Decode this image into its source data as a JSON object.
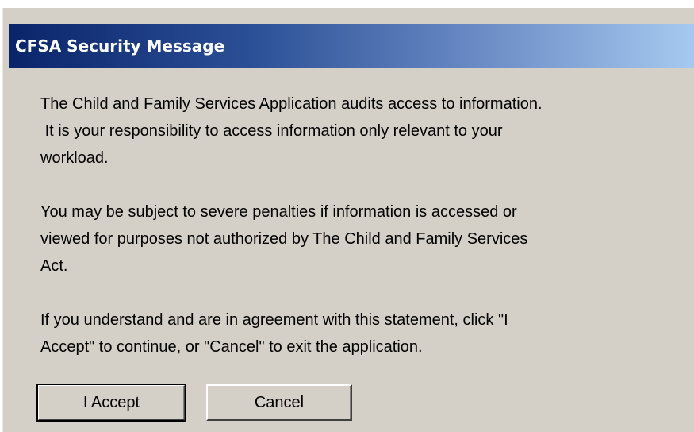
{
  "window": {
    "title": "CFSA Security Message"
  },
  "message": {
    "paragraph1": "The Child and Family Services Application audits access to information.\n It is your responsibility to access information only relevant to your\nworkload.",
    "paragraph2": "You may be subject to severe penalties if information is accessed or\nviewed for purposes not authorized by The Child and Family Services\nAct.",
    "paragraph3": "If you understand and are in agreement with this statement, click \"I\nAccept\" to continue, or \"Cancel\" to exit the application."
  },
  "buttons": {
    "accept_label": "I Accept",
    "cancel_label": "Cancel"
  },
  "colors": {
    "titlebar_start": "#0a246a",
    "titlebar_end": "#a6caf0",
    "dialog_background": "#d4d0c8"
  }
}
